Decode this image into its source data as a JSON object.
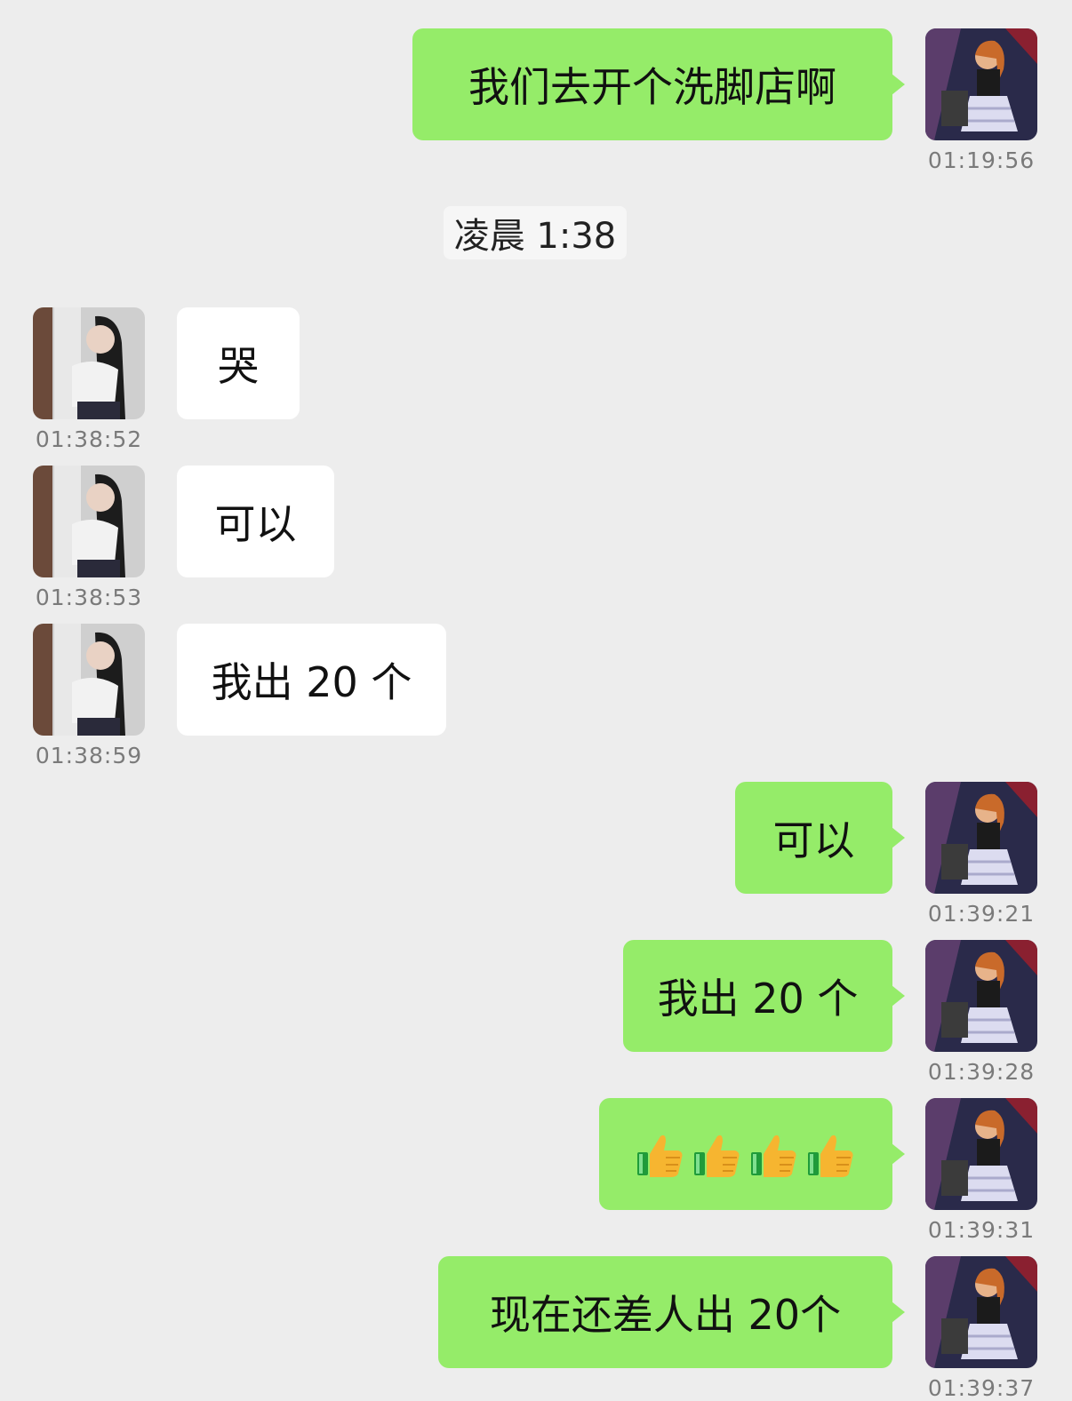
{
  "system_time": "凌晨 1:38",
  "messages": [
    {
      "side": "right",
      "text": "我们去开个洗脚店啊",
      "time": "01:19:56"
    },
    {
      "side": "left",
      "text": "哭",
      "time": "01:38:52"
    },
    {
      "side": "left",
      "text": "可以",
      "time": "01:38:53"
    },
    {
      "side": "left",
      "text": "我出 20 个",
      "time": "01:38:59"
    },
    {
      "side": "right",
      "text": "可以",
      "time": "01:39:21"
    },
    {
      "side": "right",
      "text": "我出 20 个",
      "time": "01:39:28"
    },
    {
      "side": "right",
      "text": "👍👍👍👍",
      "time": "01:39:31"
    },
    {
      "side": "right",
      "text": "现在还差人出 20个",
      "time": "01:39:37"
    }
  ],
  "colors": {
    "background": "#ededed",
    "my_bubble": "#95ec69",
    "their_bubble": "#ffffff",
    "timestamp": "#7a7a7a"
  },
  "icons": {
    "thumbs_up": "thumbs-up-icon",
    "my_avatar": "anime-girl-avatar",
    "their_avatar": "girl-photo-avatar"
  }
}
